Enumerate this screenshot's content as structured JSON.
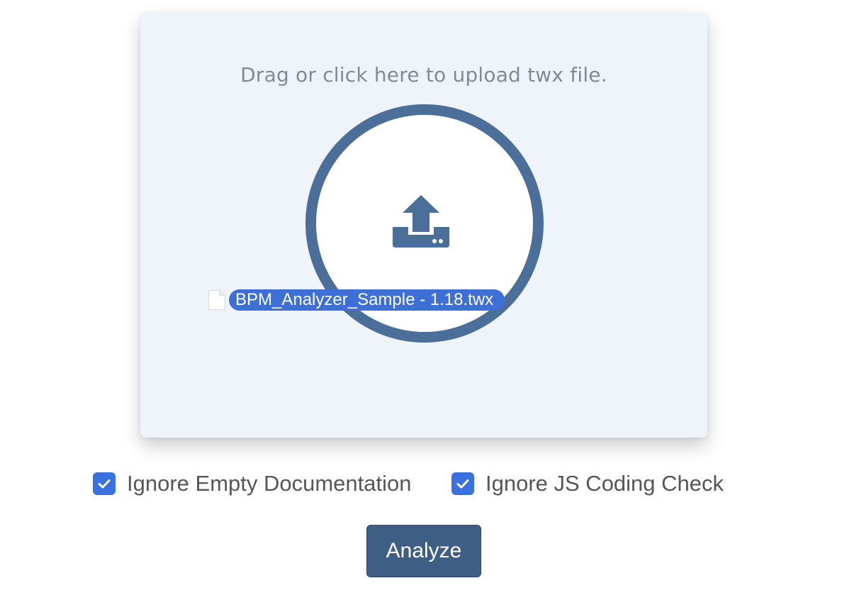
{
  "upload": {
    "prompt": "Drag or click here to upload twx file.",
    "dragged_file_name": "BPM_Analyzer_Sample - 1.18.twx",
    "icon": "upload-icon"
  },
  "options": [
    {
      "label": "Ignore Empty Documentation",
      "checked": true
    },
    {
      "label": "Ignore JS Coding Check",
      "checked": true
    }
  ],
  "actions": {
    "analyze_label": "Analyze"
  },
  "colors": {
    "accent": "#4b6f99",
    "checkbox": "#3a71de",
    "button": "#3e5e84",
    "dropzone_bg": "#eff4fa"
  }
}
